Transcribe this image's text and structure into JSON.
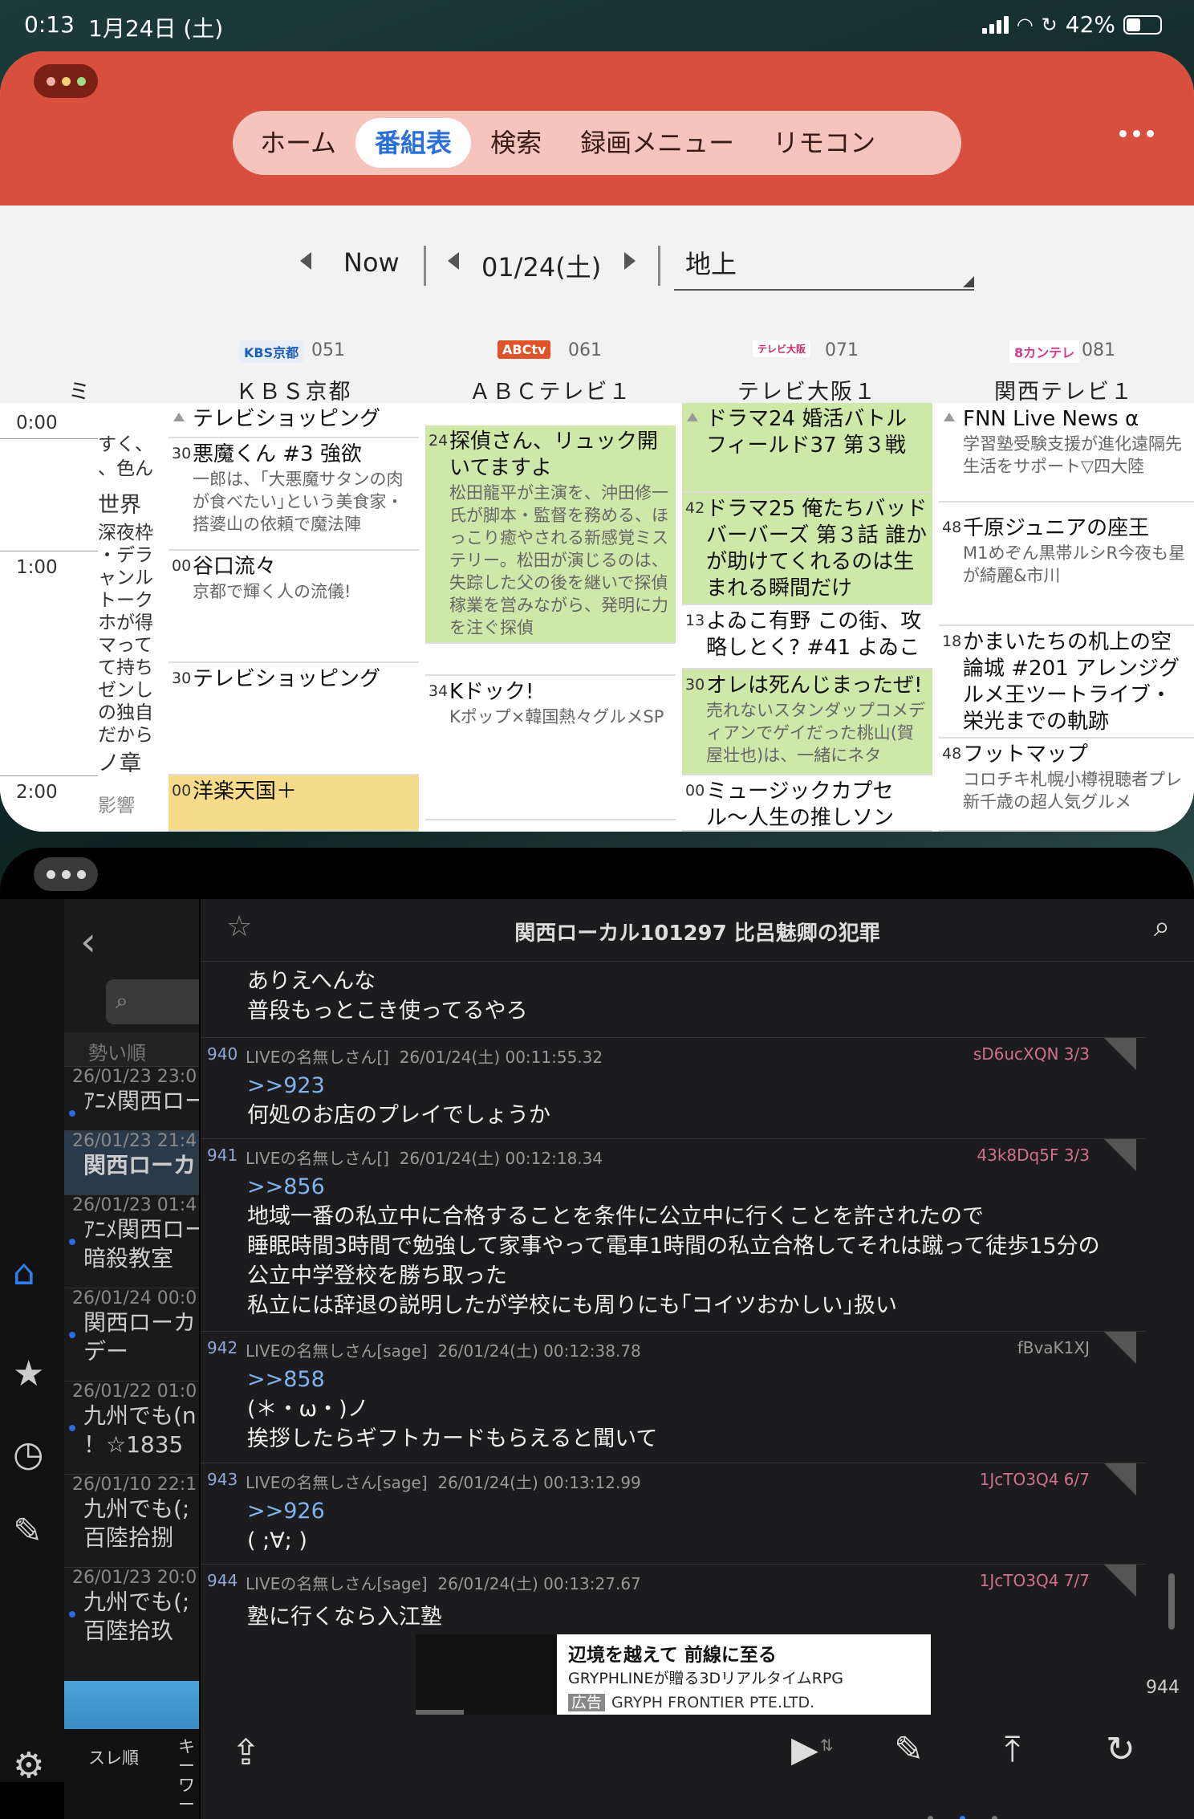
{
  "status": {
    "time": "0:13",
    "date": "1月24日 (土)",
    "battery": "42%",
    "battery_level": 0.42
  },
  "epg": {
    "tabs": [
      {
        "label": "ホーム"
      },
      {
        "label": "番組表",
        "active": true
      },
      {
        "label": "検索"
      },
      {
        "label": "録画メニュー"
      },
      {
        "label": "リモコン"
      }
    ],
    "now": "Now",
    "date": "01/24(土)",
    "source": "地上",
    "channels": [
      {
        "logo": "KBS京都",
        "num": "051",
        "name": "ＫＢＳ京都",
        "color": "#1d5fb8"
      },
      {
        "logo": "ABCtv",
        "num": "061",
        "name": "ＡＢＣテレビ１",
        "color": "#e0522a"
      },
      {
        "logo": "テレビ大阪",
        "num": "071",
        "name": "テレビ大阪１",
        "color": "#c92b6b"
      },
      {
        "logo": "8カンテレ",
        "num": "081",
        "name": "関西テレビ１",
        "color": "#d53a8a"
      }
    ],
    "left_partial_header": "ミ",
    "times": [
      "0:00",
      "1:00",
      "2:00"
    ],
    "narrow_col": [
      "すく、",
      "、色ん",
      "世界",
      "深夜枠",
      "・デラ",
      "ャンル",
      "トーク",
      "ホが得",
      "マって",
      "て持ち",
      "ゼンし",
      "の独自",
      "だから",
      "ノ章",
      "影響"
    ],
    "kbs": [
      {
        "min": "",
        "title": "テレビショッピング",
        "desc": ""
      },
      {
        "min": "30",
        "title": "悪魔くん #3 強欲",
        "desc": "一郎は、｢大悪魔サタンの肉が食べたい｣という美食家・搭婆山の依頼で魔法陣"
      },
      {
        "min": "00",
        "title": "谷口流々",
        "desc": "京都で輝く人の流儀!"
      },
      {
        "min": "30",
        "title": "テレビショッピング",
        "desc": ""
      },
      {
        "min": "00",
        "title": "洋楽天国＋",
        "desc": ""
      }
    ],
    "abc": [
      {
        "min": "24",
        "title": "探偵さん、リュック開いてますよ",
        "desc": "松田龍平が主演を、沖田修一氏が脚本・監督を務める、ほっこり癒やされる新感覚ミステリー。松田が演じるのは、失踪した父の後を継いで探偵稼業を営みながら、発明に力を注ぐ探偵"
      },
      {
        "min": "34",
        "title": "Kドック!",
        "desc": "Kポップ×韓国熱々グルメSP"
      }
    ],
    "tvo": [
      {
        "min": "",
        "title": "ドラマ24 婚活バトルフィールド37 第３戦",
        "desc": ""
      },
      {
        "min": "42",
        "title": "ドラマ25 俺たちバッドバーバーズ 第３話 誰かが助けてくれるのは生まれる瞬間だけ",
        "desc": ""
      },
      {
        "min": "13",
        "title": "よゐこ有野 この街、攻略しとく? #41 よゐこ",
        "desc": ""
      },
      {
        "min": "30",
        "title": "オレは死んじまったぜ!",
        "desc": "売れないスタンダップコメディアンでゲイだった桃山(賀屋壮也)は、一緒にネタ"
      },
      {
        "min": "00",
        "title": "ミュージックカプセル〜人生の推しソング〜",
        "desc": ""
      }
    ],
    "ktv": [
      {
        "min": "",
        "title": "FNN Live News α",
        "desc": "学習塾受験支援が進化遠隔先生活をサポート▽四大陸"
      },
      {
        "min": "48",
        "title": "千原ジュニアの座王",
        "desc": "M1めぞん黒帯ルシR今夜も星が綺麗&市川"
      },
      {
        "min": "18",
        "title": "かまいたちの机上の空論城 #201 アレンジグルメ王ツートライブ・栄光までの軌跡",
        "desc": ""
      },
      {
        "min": "48",
        "title": "フットマップ",
        "desc": "コロチキ札幌小樽視聴者プレ新千歳の超人気グルメ"
      }
    ]
  },
  "bbs": {
    "sidebar": {
      "order": "勢い順",
      "items": [
        {
          "date": "26/01/23 23:0",
          "title": "ｱﾆﾒ関西ロー"
        },
        {
          "date": "26/01/23 21:4",
          "title": "関西ローカ"
        },
        {
          "date": "26/01/23 01:4",
          "title": "ｱﾆﾒ関西ロー",
          "title2": "暗殺教室"
        },
        {
          "date": "26/01/24 00:0",
          "title": "関西ローカ",
          "title2": "デー"
        },
        {
          "date": "26/01/22 01:0",
          "title": "九州でも(n",
          "title2": "！☆1835"
        },
        {
          "date": "26/01/10 22:1",
          "title": "九州でも(;",
          "title2": "百陸拾捌"
        },
        {
          "date": "26/01/23 20:0",
          "title": "九州でも(;",
          "title2": "百陸拾玖"
        }
      ],
      "bottom_tab1": "スレ順",
      "bottom_tab2": "キー ワー"
    },
    "thread_title": "関西ローカル101297 比呂魅卿の犯罪",
    "prev_lines": [
      "ありえへんな",
      "普段もっとこき使ってるやろ"
    ],
    "posts": [
      {
        "no": "940",
        "name": "LIVEの名無しさん[]",
        "date": "26/01/24(土) 00:11:55.32",
        "id": "sD6ucXQN 3/3",
        "id_color": "#d07090",
        "ref": ">>923",
        "lines": [
          "何処のお店のプレイでしょうか"
        ]
      },
      {
        "no": "941",
        "name": "LIVEの名無しさん[]",
        "date": "26/01/24(土) 00:12:18.34",
        "id": "43k8Dq5F 3/3",
        "id_color": "#d07090",
        "ref": ">>856",
        "lines": [
          "地域一番の私立中に合格することを条件に公立中に行くことを許されたので",
          "睡眠時間3時間で勉強して家事やって電車1時間の私立合格してそれは蹴って徒歩15分の",
          "公立中学登校を勝ち取った",
          "私立には辞退の説明したが学校にも周りにも｢コイツおかしい｣扱い"
        ]
      },
      {
        "no": "942",
        "name": "LIVEの名無しさん[sage]",
        "date": "26/01/24(土) 00:12:38.78",
        "id": "fBvaK1XJ",
        "id_color": "#999999",
        "ref": ">>858",
        "lines": [
          "(＊・ω・)ノ",
          "挨拶したらギフトカードもらえると聞いて"
        ]
      },
      {
        "no": "943",
        "name": "LIVEの名無しさん[sage]",
        "date": "26/01/24(土) 00:13:12.99",
        "id": "1JcTO3Q4 6/7",
        "id_color": "#d07090",
        "ref": ">>926",
        "lines": [
          "( ;∀; )"
        ]
      },
      {
        "no": "944",
        "name": "LIVEの名無しさん[sage]",
        "date": "26/01/24(土) 00:13:27.67",
        "id": "1JcTO3Q4 7/7",
        "id_color": "#d07090",
        "ref": "",
        "lines": [
          "塾に行くなら入江塾"
        ]
      }
    ],
    "ad": {
      "title": "辺境を越えて 前線に至る",
      "line2": "GRYPHLINEが贈る3DリアルタイムRPG",
      "badge": "広告",
      "advertiser": "GRYPH FRONTIER PTE.LTD."
    },
    "count": "944"
  }
}
